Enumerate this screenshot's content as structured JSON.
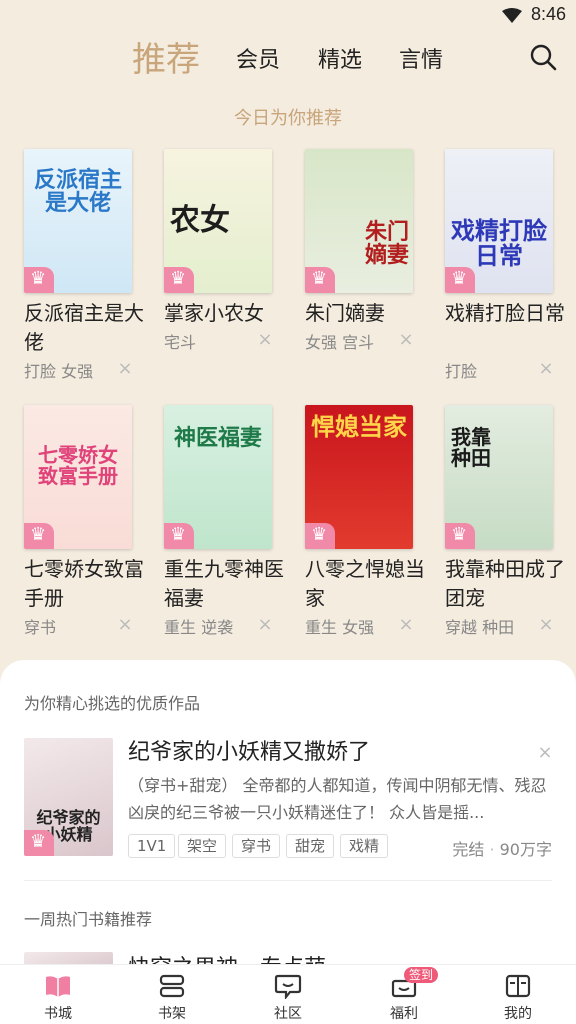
{
  "status": {
    "time": "8:46"
  },
  "top_nav": {
    "tabs": [
      {
        "label": "推荐",
        "active": true
      },
      {
        "label": "会员"
      },
      {
        "label": "精选"
      },
      {
        "label": "言情"
      }
    ]
  },
  "today": {
    "title": "今日为你推荐",
    "books": [
      {
        "title": "反派宿主是大佬",
        "cover_text": "反派宿主是大佬",
        "tags": "打脸 女强"
      },
      {
        "title": "掌家小农女",
        "cover_text": "农女",
        "tags": "宅斗"
      },
      {
        "title": "朱门嫡妻",
        "cover_text": "朱门嫡妻",
        "tags": "女强 宫斗"
      },
      {
        "title": "戏精打脸日常",
        "cover_text": "戏精打脸日常",
        "tags": "打脸"
      },
      {
        "title": "七零娇女致富手册",
        "cover_text": "七零娇女致富手册",
        "tags": "穿书"
      },
      {
        "title": "重生九零神医福妻",
        "cover_text": "神医福妻",
        "tags": "重生 逆袭"
      },
      {
        "title": "八零之悍媳当家",
        "cover_text": "悍媳当家",
        "tags": "重生 女强"
      },
      {
        "title": "我靠种田成了团宠",
        "cover_text": "我靠种田",
        "tags": "穿越 种田"
      }
    ]
  },
  "featured": {
    "section_title": "为你精心挑选的优质作品",
    "title": "纪爷家的小妖精又撒娇了",
    "cover_text": "纪爷家的小妖精",
    "description": "（穿书+甜宠） 全帝都的人都知道，传闻中阴郁无情、残忍凶戾的纪三爷被一只小妖精迷住了！ 众人皆是摇...",
    "tags": [
      "1V1",
      "架空",
      "穿书",
      "甜宠",
      "戏精"
    ],
    "status": "完结",
    "words": "90万字"
  },
  "weekly": {
    "section_title": "一周热门书籍推荐",
    "peek_title": "快穿之男神，专点萌"
  },
  "bottom_nav": {
    "items": [
      {
        "label": "书城",
        "icon": "book-open-icon",
        "active": true
      },
      {
        "label": "书架",
        "icon": "bookshelf-icon"
      },
      {
        "label": "社区",
        "icon": "chat-bubble-icon"
      },
      {
        "label": "福利",
        "icon": "gift-box-icon",
        "badge": "签到"
      },
      {
        "label": "我的",
        "icon": "profile-book-icon"
      }
    ]
  },
  "colors": {
    "accent": "#c8a57a",
    "background": "#f4ecdf",
    "badge": "#ef5a79",
    "vip_crown": "#f08aa8"
  }
}
